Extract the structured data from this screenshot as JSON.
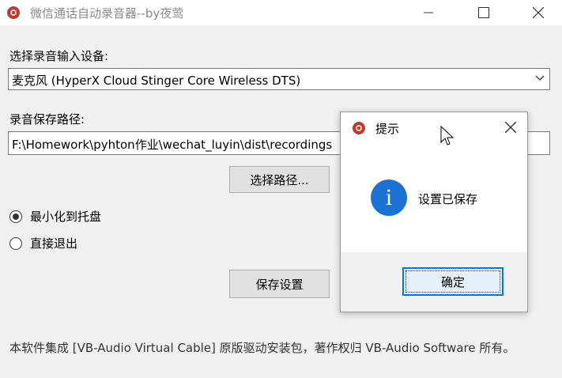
{
  "window": {
    "title": "微信通话自动录音器--by夜莺",
    "icon": "app-logo-icon",
    "controls": [
      "minimize-icon",
      "maximize-icon",
      "close-icon"
    ]
  },
  "device": {
    "label": "选择录音输入设备:",
    "selected": "麦克风 (HyperX Cloud Stinger Core Wireless DTS)"
  },
  "path": {
    "label": "录音保存路径:",
    "value": "F:\\Homework\\pyhton作业\\wechat_luyin\\dist\\recordings",
    "browse_button": "选择路径..."
  },
  "options": [
    {
      "label": "最小化到托盘",
      "checked": true
    },
    {
      "label": "直接退出",
      "checked": false
    }
  ],
  "save_button": "保存设置",
  "footer": "本软件集成 [VB-Audio Virtual Cable] 原版驱动安装包，著作权归 VB-Audio Software 所有。",
  "dialog": {
    "title": "提示",
    "message": "设置已保存",
    "ok_button": "确定",
    "icon": "info-icon",
    "info_glyph": "i"
  },
  "colors": {
    "accent": "#0078d7",
    "info_blue": "#1a73d4",
    "logo_red": "#c0392b"
  }
}
